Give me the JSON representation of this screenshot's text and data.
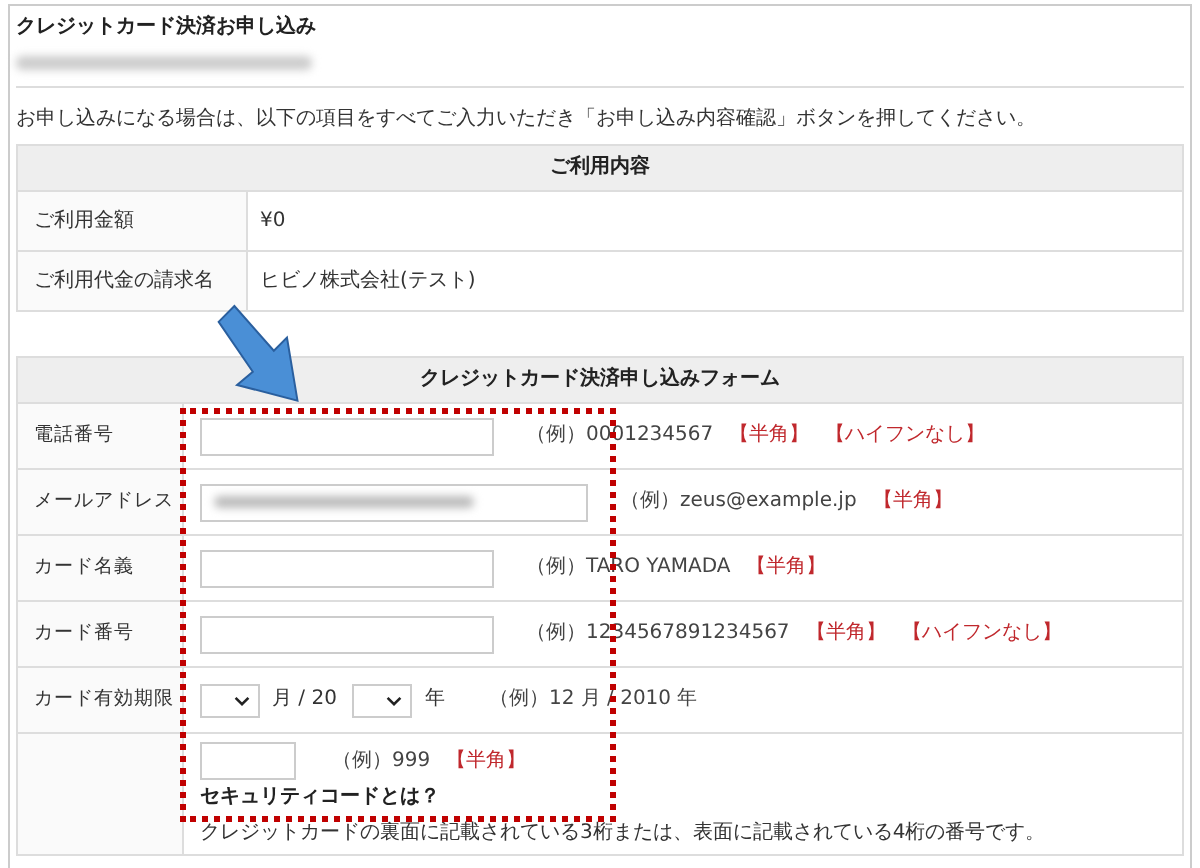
{
  "title": "クレジットカード決済お申し込み",
  "subtitle_obscured": true,
  "instruction": "お申し込みになる場合は、以下の項目をすべてご入力いただき「お申し込み内容確認」ボタンを押してください。",
  "usage_table": {
    "heading": "ご利用内容",
    "rows": [
      {
        "label": "ご利用金額",
        "value": "¥0"
      },
      {
        "label": "ご利用代金の請求名",
        "value": "ヒビノ株式会社(テスト)"
      }
    ]
  },
  "form_table": {
    "heading": "クレジットカード決済申し込みフォーム",
    "rows": [
      {
        "kind": "text",
        "label": "電話番号",
        "example": "（例）0001234567",
        "notes": [
          "【半角】",
          "【ハイフンなし】"
        ]
      },
      {
        "kind": "email",
        "label": "メールアドレス",
        "value_obscured": true,
        "example": "（例）zeus@example.jp",
        "notes": [
          "【半角】"
        ]
      },
      {
        "kind": "text",
        "label": "カード名義",
        "example": "（例）TARO YAMADA",
        "notes": [
          "【半角】"
        ]
      },
      {
        "kind": "text",
        "label": "カード番号",
        "example": "（例）1234567891234567",
        "notes": [
          "【半角】",
          "【ハイフンなし】"
        ]
      },
      {
        "kind": "expiry",
        "label": "カード有効期限",
        "month_suffix": "月 / 20",
        "year_suffix": "年",
        "example": "（例）12 月 / 2010 年"
      },
      {
        "kind": "security",
        "label": "",
        "example": "（例）999",
        "notes": [
          "【半角】"
        ],
        "help_title": "セキュリティコードとは？",
        "help_text": "クレジットカードの裏面に記載されている3桁または、表面に記載されている4桁の番号です。"
      }
    ]
  },
  "annotation": {
    "arrow": true,
    "highlight_box": true
  }
}
